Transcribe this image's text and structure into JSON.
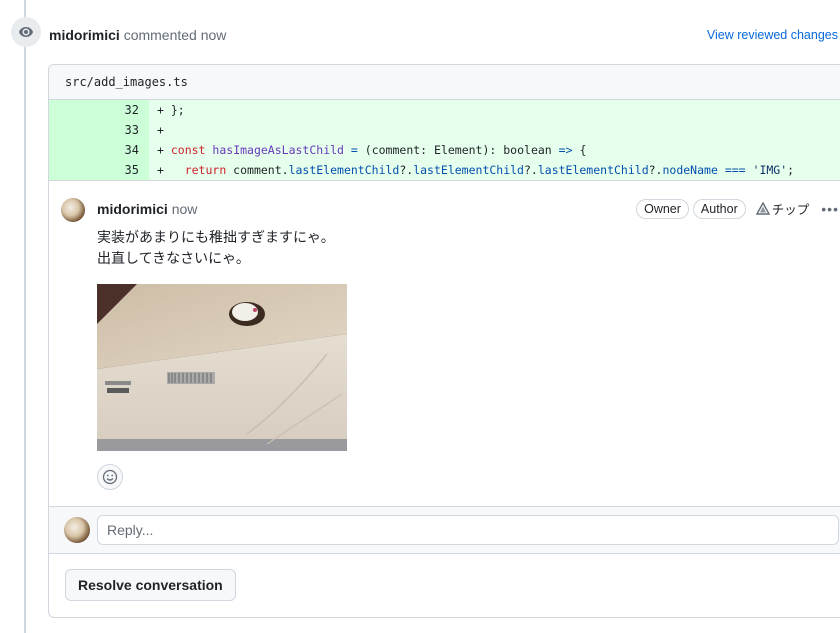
{
  "event": {
    "icon": "eye-icon",
    "author": "midorimici",
    "action": "commented now",
    "view_changes_label": "View reviewed changes"
  },
  "file": {
    "path": "src/add_images.ts",
    "lines": [
      {
        "num": "32",
        "tokens": [
          {
            "t": "+ };",
            "c": ""
          }
        ]
      },
      {
        "num": "33",
        "tokens": [
          {
            "t": "+",
            "c": ""
          }
        ]
      },
      {
        "num": "34",
        "tokens": [
          {
            "t": "+ ",
            "c": ""
          },
          {
            "t": "const",
            "c": "kw"
          },
          {
            "t": " ",
            "c": ""
          },
          {
            "t": "hasImageAsLastChild",
            "c": "fn"
          },
          {
            "t": " ",
            "c": ""
          },
          {
            "t": "=",
            "c": "prop"
          },
          {
            "t": " (comment: Element): boolean ",
            "c": ""
          },
          {
            "t": "=>",
            "c": "prop"
          },
          {
            "t": " {",
            "c": ""
          }
        ]
      },
      {
        "num": "35",
        "tokens": [
          {
            "t": "+   ",
            "c": ""
          },
          {
            "t": "return",
            "c": "kw"
          },
          {
            "t": " comment.",
            "c": ""
          },
          {
            "t": "lastElementChild",
            "c": "prop"
          },
          {
            "t": "?.",
            "c": ""
          },
          {
            "t": "lastElementChild",
            "c": "prop"
          },
          {
            "t": "?.",
            "c": ""
          },
          {
            "t": "lastElementChild",
            "c": "prop"
          },
          {
            "t": "?.",
            "c": ""
          },
          {
            "t": "nodeName",
            "c": "prop"
          },
          {
            "t": " ",
            "c": ""
          },
          {
            "t": "===",
            "c": "prop"
          },
          {
            "t": " ",
            "c": ""
          },
          {
            "t": "'IMG'",
            "c": "str"
          },
          {
            "t": ";",
            "c": ""
          }
        ]
      }
    ]
  },
  "comment": {
    "author": "midorimici",
    "time": "now",
    "labels": [
      "Owner",
      "Author"
    ],
    "tip_label": "チップ",
    "body_lines": [
      "実装があまりにも稚拙すぎますにゃ。",
      "出直してきなさいにゃ。"
    ],
    "image_alt": "Cat peeking out of a hole in a cardboard box labeled HEMNES"
  },
  "reply": {
    "placeholder": "Reply..."
  },
  "resolve_label": "Resolve conversation",
  "colors": {
    "link": "#0969da",
    "added_line_bg": "#e6ffec",
    "added_num_bg": "#ccffd8",
    "border": "#d0d7de"
  }
}
